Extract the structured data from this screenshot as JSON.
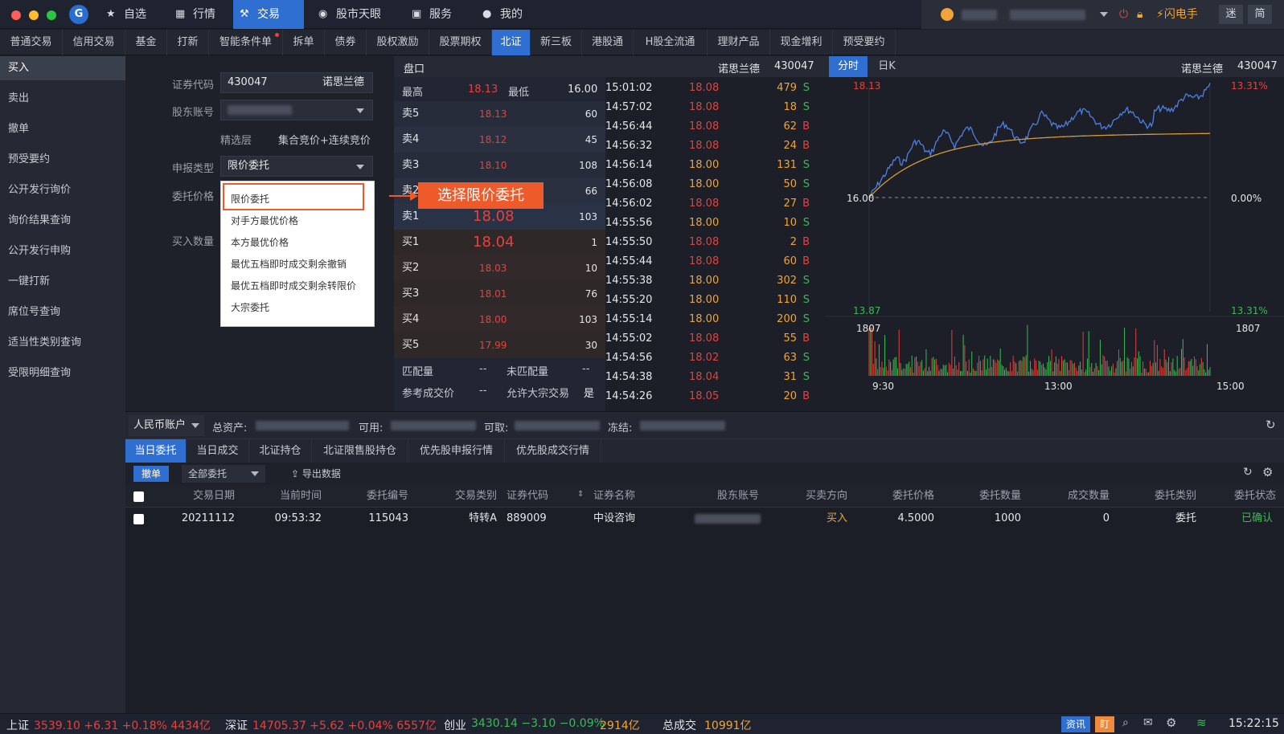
{
  "nav": {
    "tabs": [
      {
        "label": "自选",
        "icon": "star-icon"
      },
      {
        "label": "行情",
        "icon": "chart-icon"
      },
      {
        "label": "交易",
        "icon": "hammer-icon"
      },
      {
        "label": "股市天眼",
        "icon": "eye-icon"
      },
      {
        "label": "服务",
        "icon": "briefcase-icon"
      },
      {
        "label": "我的",
        "icon": "person-icon"
      }
    ],
    "flash": "闪电手",
    "mini": "迷",
    "simple": "简"
  },
  "subnav": [
    "普通交易",
    "信用交易",
    "基金",
    "打新",
    "智能条件单",
    "拆单",
    "债券",
    "股权激励",
    "股票期权",
    "北证",
    "新三板",
    "港股通",
    "H股全流通",
    "理财产品",
    "现金增利",
    "预受要约"
  ],
  "sidebar": [
    "买入",
    "卖出",
    "撤单",
    "预受要约",
    "公开发行询价",
    "询价结果查询",
    "公开发行申购",
    "一键打新",
    "席位号查询",
    "适当性类别查询",
    "受限明细查询"
  ],
  "form": {
    "code_label": "证券代码",
    "code": "430047",
    "name": "诺思兰德",
    "holder_label": "股东账号",
    "tier": "精选层",
    "mode": "集合竞价+连续竞价",
    "type_label": "申报类型",
    "type": "限价委托",
    "price_label": "委托价格",
    "qty_label": "买入数量"
  },
  "dropdown": [
    "限价委托",
    "对手方最优价格",
    "本方最优价格",
    "最优五档即时成交剩余撤销",
    "最优五档即时成交剩余转限价",
    "大宗委托"
  ],
  "callout": "选择限价委托",
  "book": {
    "title": "盘口",
    "name": "诺思兰德",
    "code": "430047",
    "high_label": "最高",
    "high": "18.13",
    "low_label": "最低",
    "low": "16.00",
    "rows": [
      {
        "l": "卖5",
        "p": "18.13",
        "v": "60"
      },
      {
        "l": "卖4",
        "p": "18.12",
        "v": "45"
      },
      {
        "l": "卖3",
        "p": "18.10",
        "v": "108"
      },
      {
        "l": "卖2",
        "p": "",
        "v": "66"
      },
      {
        "l": "卖1",
        "p": "18.08",
        "v": "103"
      },
      {
        "l": "买1",
        "p": "18.04",
        "v": "1"
      },
      {
        "l": "买2",
        "p": "18.03",
        "v": "10"
      },
      {
        "l": "买3",
        "p": "18.01",
        "v": "76"
      },
      {
        "l": "买4",
        "p": "18.00",
        "v": "103"
      },
      {
        "l": "买5",
        "p": "17.99",
        "v": "30"
      }
    ],
    "match_label": "匹配量",
    "match": "--",
    "unmatch_label": "未匹配量",
    "unmatch": "--",
    "ref_label": "参考成交价",
    "ref": "--",
    "block_label": "允许大宗交易",
    "block": "是"
  },
  "ticks": [
    [
      "15:01:02",
      "18.08",
      "479",
      "S"
    ],
    [
      "14:57:02",
      "18.08",
      "18",
      "S"
    ],
    [
      "14:56:44",
      "18.08",
      "62",
      "B"
    ],
    [
      "14:56:32",
      "18.08",
      "24",
      "B"
    ],
    [
      "14:56:14",
      "18.00",
      "131",
      "S"
    ],
    [
      "14:56:08",
      "18.00",
      "50",
      "S"
    ],
    [
      "14:56:02",
      "18.08",
      "27",
      "B"
    ],
    [
      "14:55:56",
      "18.00",
      "10",
      "S"
    ],
    [
      "14:55:50",
      "18.08",
      "2",
      "B"
    ],
    [
      "14:55:44",
      "18.08",
      "60",
      "B"
    ],
    [
      "14:55:38",
      "18.00",
      "302",
      "S"
    ],
    [
      "14:55:20",
      "18.00",
      "110",
      "S"
    ],
    [
      "14:55:14",
      "18.00",
      "200",
      "S"
    ],
    [
      "14:55:02",
      "18.08",
      "55",
      "B"
    ],
    [
      "14:54:56",
      "18.02",
      "63",
      "S"
    ],
    [
      "14:54:38",
      "18.04",
      "31",
      "S"
    ],
    [
      "14:54:26",
      "18.05",
      "20",
      "B"
    ]
  ],
  "chart": {
    "tab1": "分时",
    "tab2": "日K",
    "name": "诺思兰德",
    "code": "430047",
    "pmax": "18.13",
    "pmid": "16.00",
    "pmin": "13.87",
    "rmax": "13.31%",
    "rmid": "0.00%",
    "rmin": "13.31%",
    "vol": "1807",
    "vol_r": "1807",
    "x": [
      "9:30",
      "13:00",
      "15:00"
    ]
  },
  "acct": {
    "cur": "人民币账户",
    "total": "总资产:",
    "avail": "可用:",
    "draw": "可取:",
    "frozen": "冻结:"
  },
  "btabs": [
    "当日委托",
    "当日成交",
    "北证持仓",
    "北证限售股持仓",
    "优先股申报行情",
    "优先股成交行情"
  ],
  "tools": {
    "cancel": "撤单",
    "filter": "全部委托",
    "export": "导出数据"
  },
  "table": {
    "headers": [
      "交易日期",
      "当前时间",
      "委托编号",
      "交易类别",
      "证券代码",
      "证券名称",
      "股东账号",
      "买卖方向",
      "委托价格",
      "委托数量",
      "成交数量",
      "委托类别",
      "委托状态"
    ],
    "row": [
      "20211112",
      "09:53:32",
      "115043",
      "特转A",
      "889009",
      "中设咨询",
      "",
      "买入",
      "4.5000",
      "1000",
      "0",
      "委托",
      "已确认"
    ]
  },
  "status": {
    "sh": "上证",
    "sh_v": "3539.10 +6.31 +0.18% 4434亿",
    "sz": "深证",
    "sz_v": "14705.37 +5.62 +0.04% 6557亿",
    "cy": "创业",
    "cy_v": "3430.14 −3.10 −0.09%",
    "cy_amt": "2914亿",
    "total": "总成交",
    "total_v": "10991亿",
    "news": "资讯",
    "ding": "盯",
    "time": "15:22:15"
  },
  "colors": {
    "accent": "#2f6fd2",
    "up": "#e8413c",
    "down": "#3cba54",
    "line": "#4f7fe0",
    "avg": "#d49a3a"
  }
}
